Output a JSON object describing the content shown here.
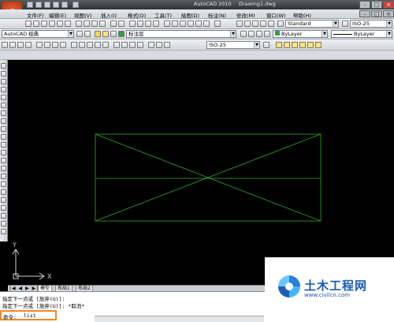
{
  "window": {
    "title": "AutoCAD 2010",
    "document": "Drawing1.dwg"
  },
  "menu": [
    "文件(F)",
    "编辑(E)",
    "视图(V)",
    "插入(I)",
    "格式(O)",
    "工具(T)",
    "绘图(D)",
    "标注(N)",
    "修改(M)",
    "窗口(W)",
    "帮助(H)"
  ],
  "toolbar": {
    "textstyle": "Standard",
    "dimstyle": "ISO-25",
    "workspace": "AutoCAD 经典",
    "layer": "标注层",
    "color": "ByLayer",
    "linetype": "ByLayer",
    "dimstyle2": "ISO-25"
  },
  "ucs": {
    "x": "X",
    "y": "Y"
  },
  "tabs": [
    "模型",
    "布局1",
    "布局2"
  ],
  "command": {
    "line1": "指定下一点或 [放弃(U)]:",
    "line2": "指定下一点或 [放弃(U)]: *取消*",
    "prompt": "命令:",
    "value": "list"
  },
  "watermark": {
    "name": "土木工程网",
    "url": "www.civilcn.com"
  }
}
